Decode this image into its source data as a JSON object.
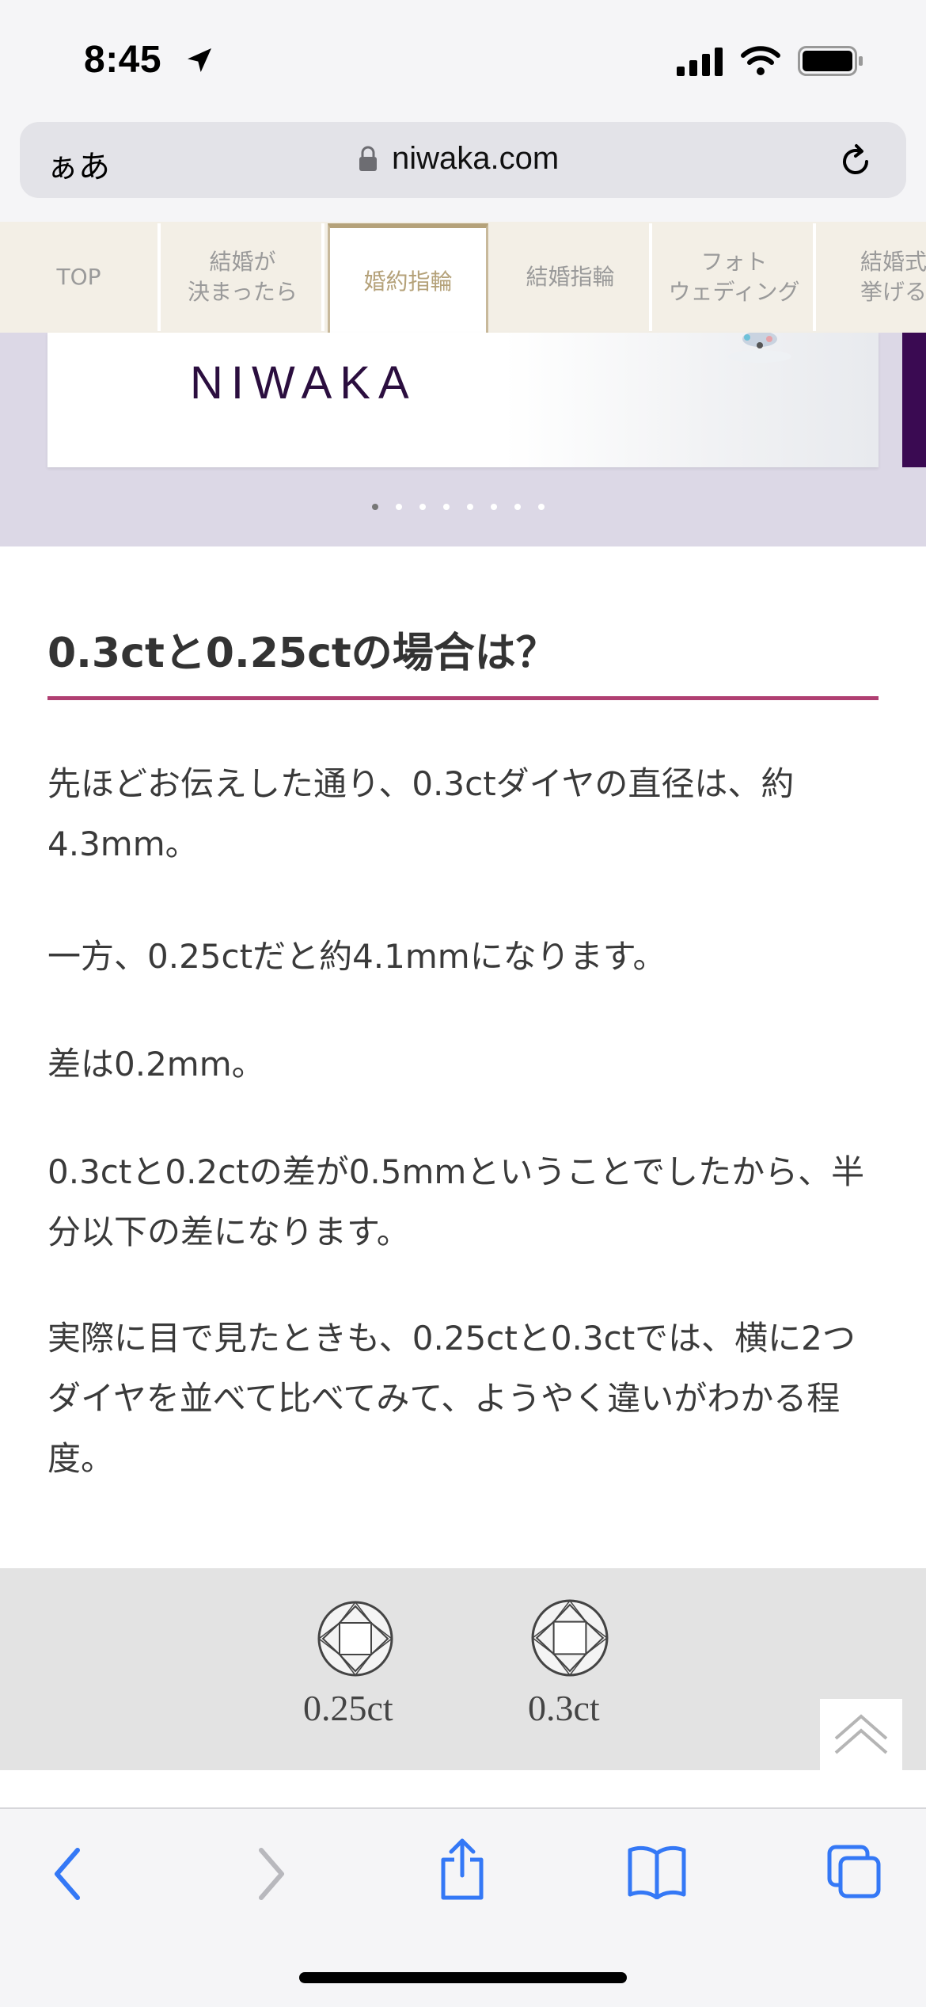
{
  "status": {
    "time": "8:45"
  },
  "browser": {
    "aa": "ぁあ",
    "url": "niwaka.com"
  },
  "nav": {
    "tabs": [
      {
        "label": "TOP"
      },
      {
        "label": "結婚が\n決まったら"
      },
      {
        "label": "婚約指輪",
        "active": true
      },
      {
        "label": "結婚指輪"
      },
      {
        "label": "フォト\nウェディング"
      },
      {
        "label": "結婚式\n挙げる"
      }
    ]
  },
  "banner": {
    "logo": "NIWAKA",
    "slide_count": 8,
    "active_slide": 1
  },
  "article": {
    "heading": "0.3ctと0.25ctの場合は？",
    "paragraphs": [
      "先ほどお伝えした通り、0.3ctダイヤの直径は、約4.3mm。",
      "一方、0.25ctだと約4.1mmになります。",
      "差は0.2mm。",
      "0.3ctと0.2ctの差が0.5mmということでしたから、半分以下の差になります。",
      "実際に目で見たときも、0.25ctと0.3ctでは、横に2つダイヤを並べて比べてみて、ようやく違いがわかる程度。"
    ]
  },
  "compare": {
    "labels": [
      "0.25ct",
      "0.3ct"
    ]
  },
  "colors": {
    "accent": "#b03f72",
    "tab_active": "#b5a27a",
    "banner_bg": "#dcd8e6",
    "ios_blue": "#3478f6"
  }
}
